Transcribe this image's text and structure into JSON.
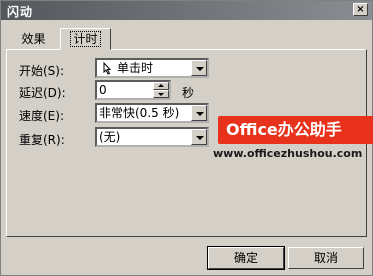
{
  "window": {
    "title": "闪动",
    "close_symbol": "×"
  },
  "tabs": [
    {
      "label": "效果"
    },
    {
      "label": "计时"
    }
  ],
  "fields": {
    "start": {
      "label": "开始(S):",
      "value": "单击时"
    },
    "delay": {
      "label": "延迟(D):",
      "value": "0",
      "unit": "秒"
    },
    "speed": {
      "label": "速度(E):",
      "value": "非常快(0.5 秒)"
    },
    "repeat": {
      "label": "重复(R):",
      "value": "(无)"
    }
  },
  "buttons": {
    "ok": "确定",
    "cancel": "取消"
  },
  "watermark": {
    "badge": "Office办公助手",
    "url": "www.officezhushou.com"
  },
  "colors": {
    "title_bar": "#6a6e72",
    "dialog_bg": "#d4d0c8",
    "badge_bg": "#e8321c"
  }
}
